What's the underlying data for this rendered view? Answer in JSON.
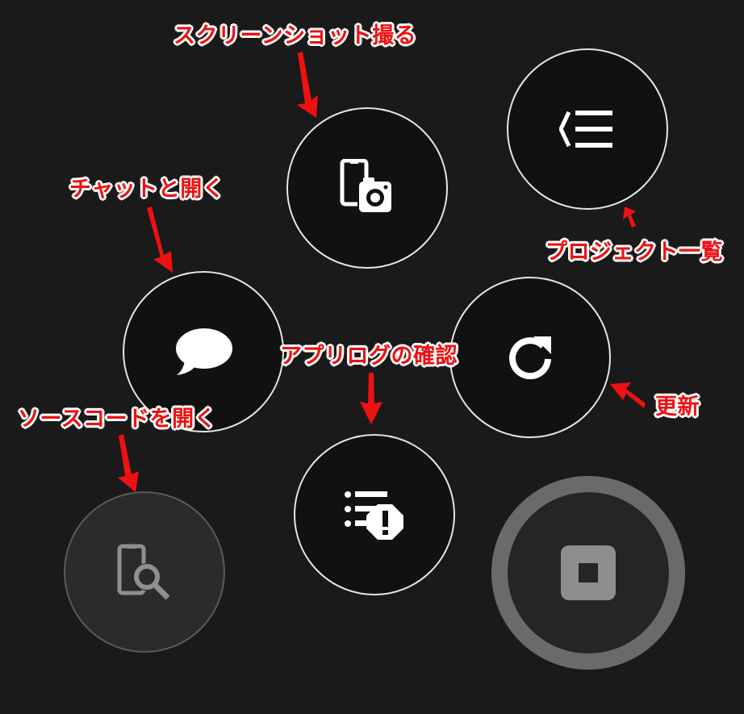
{
  "buttons": {
    "screenshot": {
      "icon": "phone-camera-icon"
    },
    "project_list": {
      "icon": "list-collapse-icon"
    },
    "chat": {
      "icon": "chat-bubble-icon"
    },
    "refresh": {
      "icon": "refresh-icon"
    },
    "app_log": {
      "icon": "log-warning-icon"
    },
    "source_code": {
      "icon": "phone-search-icon"
    },
    "stop": {
      "icon": "stop-icon"
    }
  },
  "annotations": {
    "screenshot": "スクリーンショット撮る",
    "project_list": "プロジェクト一覧",
    "chat": "チャットと開く",
    "app_log": "アプリログの確認",
    "refresh": "更新",
    "source_code": "ソースコードを開く"
  },
  "colors": {
    "background": "#1a1a1a",
    "button_fill": "#111111",
    "button_border": "#e6e6e6",
    "annotation_red": "#ee1111"
  }
}
